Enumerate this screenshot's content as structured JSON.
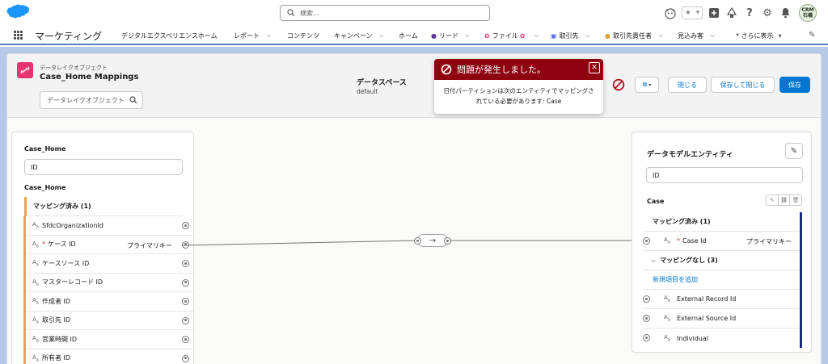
{
  "header": {
    "search_placeholder": "検索...",
    "avatar_line1": "CRM",
    "avatar_line2": "石橋",
    "icons": [
      "salesforce-cloud-icon",
      "search-icon",
      "einstein-icon",
      "star-icon",
      "plus-icon",
      "trailhead-icon",
      "help-icon",
      "gear-icon",
      "bell-icon"
    ],
    "brand_color": "#1b96ff"
  },
  "nav": {
    "app_name": "マーケティング",
    "items": [
      {
        "label": "デジタルエクスペリエンスホーム",
        "chevron": false,
        "icon": ""
      },
      {
        "label": "レポート",
        "chevron": true,
        "icon": ""
      },
      {
        "label": "コンテンツ",
        "chevron": false,
        "icon": ""
      },
      {
        "label": "キャンペーン",
        "chevron": true,
        "icon": ""
      },
      {
        "label": "ホーム",
        "chevron": false,
        "icon": ""
      },
      {
        "label": "リード",
        "chevron": true,
        "icon": "person-icon"
      },
      {
        "label": "ファイル",
        "chevron": true,
        "icon": "flower-icon"
      },
      {
        "label": "取引先",
        "chevron": true,
        "icon": "account-icon"
      },
      {
        "label": "取引先責任者",
        "chevron": true,
        "icon": "contact-icon"
      },
      {
        "label": "見込み客",
        "chevron": true,
        "icon": ""
      },
      {
        "label": "* さらに表示",
        "chevron": true,
        "icon": ""
      }
    ]
  },
  "subheader": {
    "object_type": "データレイクオブジェクト",
    "object_name": "Case_Home Mappings",
    "search_placeholder": "データレイクオブジェクト",
    "dataspace_label": "データスペース",
    "dataspace_value": "default",
    "buttons": {
      "close": "閉じる",
      "save_close": "保存して閉じる",
      "save": "保存"
    }
  },
  "error": {
    "title": "問題が発生しました。",
    "message": "日付パーティションは次のエンティティでマッピングされている必要があります: Case",
    "accent": "#8e030f"
  },
  "left_panel": {
    "title": "Case_Home",
    "search_value": "ID",
    "section_title": "Case_Home",
    "group_label": "マッピング済み (1)",
    "fields": [
      {
        "name": "SfdcOrganizationId",
        "required": false,
        "pk": ""
      },
      {
        "name": "ケース ID",
        "required": true,
        "pk": "プライマリキー"
      },
      {
        "name": "ケースソース ID",
        "required": false,
        "pk": ""
      },
      {
        "name": "マスターレコード ID",
        "required": false,
        "pk": ""
      },
      {
        "name": "作成者 ID",
        "required": false,
        "pk": ""
      },
      {
        "name": "取引先 ID",
        "required": false,
        "pk": ""
      },
      {
        "name": "営業時間 ID",
        "required": false,
        "pk": ""
      },
      {
        "name": "所有者 ID",
        "required": false,
        "pk": ""
      }
    ]
  },
  "right_panel": {
    "title": "データモデルエンティティ",
    "search_value": "ID",
    "entity": "Case",
    "mapped_label": "マッピング済み (1)",
    "mapped_fields": [
      {
        "name": "Case Id",
        "required": true,
        "pk": "プライマリキー"
      }
    ],
    "unmapped_label": "マッピングなし (3)",
    "add_link": "新規項目を追加",
    "unmapped_fields": [
      {
        "name": "External Record Id"
      },
      {
        "name": "External Source Id"
      },
      {
        "name": "Individual"
      }
    ]
  }
}
